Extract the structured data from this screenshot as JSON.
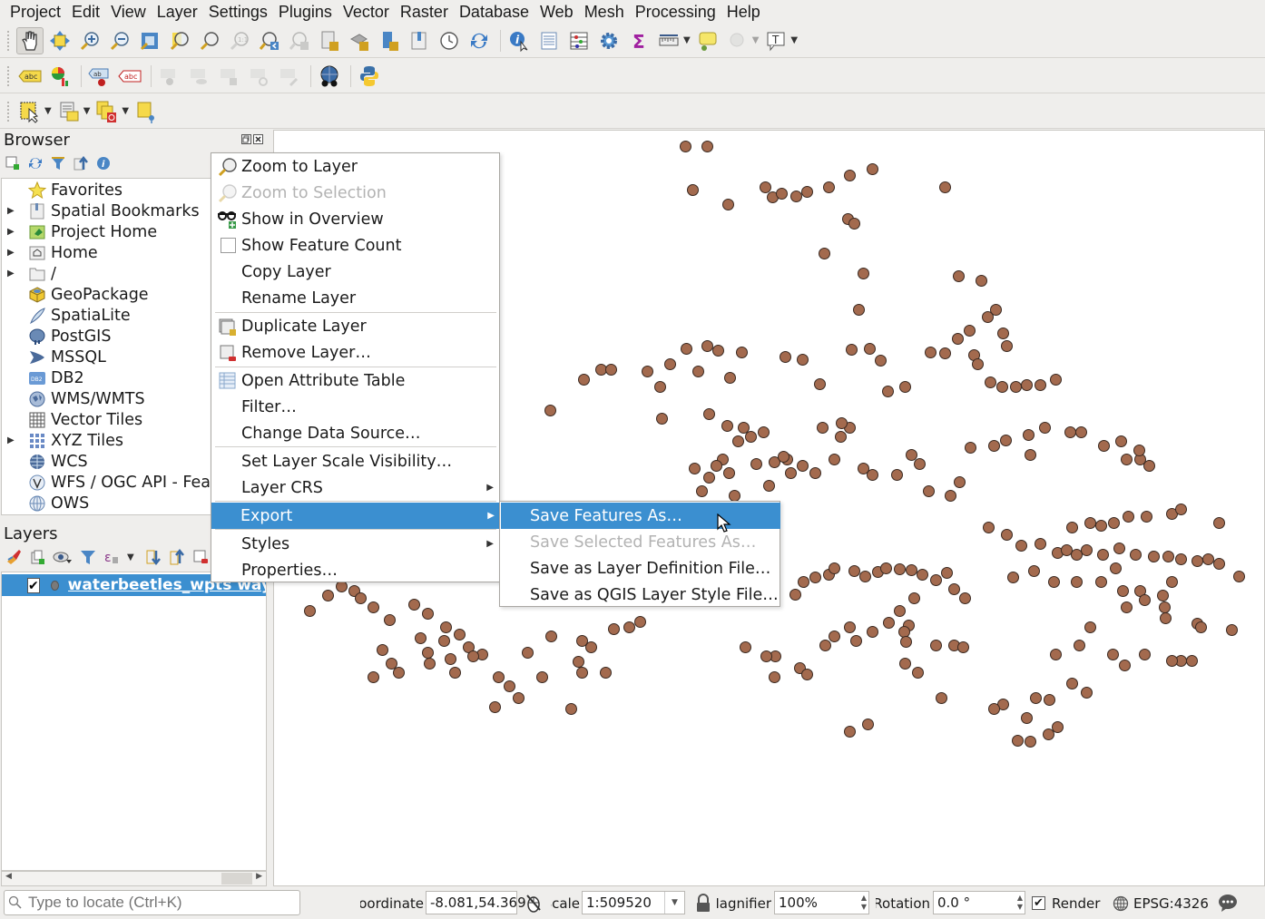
{
  "menubar": {
    "items": [
      {
        "label": "Project"
      },
      {
        "label": "Edit"
      },
      {
        "label": "View"
      },
      {
        "label": "Layer"
      },
      {
        "label": "Settings"
      },
      {
        "label": "Plugins"
      },
      {
        "label": "Vector"
      },
      {
        "label": "Raster"
      },
      {
        "label": "Database"
      },
      {
        "label": "Web"
      },
      {
        "label": "Mesh"
      },
      {
        "label": "Processing"
      },
      {
        "label": "Help"
      }
    ]
  },
  "browser": {
    "title": "Browser",
    "items": [
      {
        "label": "Favorites",
        "icon": "star-icon",
        "expandable": false
      },
      {
        "label": "Spatial Bookmarks",
        "icon": "bookmark-icon",
        "expandable": true
      },
      {
        "label": "Project Home",
        "icon": "project-home-icon",
        "expandable": true
      },
      {
        "label": "Home",
        "icon": "home-folder-icon",
        "expandable": true
      },
      {
        "label": "/",
        "icon": "folder-icon",
        "expandable": true
      },
      {
        "label": "GeoPackage",
        "icon": "geopackage-icon",
        "expandable": false
      },
      {
        "label": "SpatiaLite",
        "icon": "spatialite-icon",
        "expandable": false
      },
      {
        "label": "PostGIS",
        "icon": "postgis-icon",
        "expandable": false
      },
      {
        "label": "MSSQL",
        "icon": "mssql-icon",
        "expandable": false
      },
      {
        "label": "DB2",
        "icon": "db2-icon",
        "expandable": false
      },
      {
        "label": "WMS/WMTS",
        "icon": "wms-icon",
        "expandable": false
      },
      {
        "label": "Vector Tiles",
        "icon": "vector-tiles-icon",
        "expandable": false
      },
      {
        "label": "XYZ Tiles",
        "icon": "xyz-tiles-icon",
        "expandable": true
      },
      {
        "label": "WCS",
        "icon": "wcs-icon",
        "expandable": false
      },
      {
        "label": "WFS / OGC API - Features",
        "icon": "wfs-icon",
        "expandable": false
      },
      {
        "label": "OWS",
        "icon": "ows-icon",
        "expandable": false
      }
    ]
  },
  "layers": {
    "title": "Layers",
    "items": [
      {
        "label": "waterbeetles_wpts waypoints",
        "checked": true
      }
    ]
  },
  "context_menu": {
    "items": [
      {
        "label": "Zoom to Layer",
        "icon": "zoom-layer-icon",
        "disabled": false
      },
      {
        "label": "Zoom to Selection",
        "icon": "zoom-selection-icon",
        "disabled": true
      },
      {
        "label": "Show in Overview",
        "icon": "overview-glasses-icon",
        "disabled": false
      },
      {
        "label": "Show Feature Count",
        "icon": "checkbox",
        "disabled": false
      },
      {
        "label": "Copy Layer",
        "disabled": false
      },
      {
        "label": "Rename Layer",
        "disabled": false
      },
      {
        "label": "Duplicate Layer",
        "icon": "duplicate-layer-icon",
        "disabled": false
      },
      {
        "label": "Remove Layer…",
        "icon": "remove-layer-icon",
        "disabled": false
      },
      {
        "label": "Open Attribute Table",
        "icon": "attribute-table-icon",
        "disabled": false
      },
      {
        "label": "Filter…",
        "disabled": false
      },
      {
        "label": "Change Data Source…",
        "disabled": false
      },
      {
        "label": "Set Layer Scale Visibility…",
        "disabled": false
      },
      {
        "label": "Layer CRS",
        "submenu": true
      },
      {
        "label": "Export",
        "submenu": true,
        "highlighted": true
      },
      {
        "label": "Styles",
        "submenu": true
      },
      {
        "label": "Properties…",
        "disabled": false
      }
    ]
  },
  "export_submenu": {
    "items": [
      {
        "label": "Save Features As…",
        "highlighted": true
      },
      {
        "label": "Save Selected Features As…",
        "disabled": true
      },
      {
        "label": "Save as Layer Definition File…"
      },
      {
        "label": "Save as QGIS Layer Style File…"
      }
    ]
  },
  "statusbar": {
    "locate_placeholder": "Type to locate (Ctrl+K)",
    "coordinate_label": "Coordinate",
    "coordinate_value": "-8.081,54.369",
    "scale_label": "Scale",
    "scale_value": "1:509520",
    "magnifier_label": "Magnifier",
    "magnifier_value": "100%",
    "rotation_label": "Rotation",
    "rotation_value": "0.0 °",
    "render_label": "Render",
    "render_checked": true,
    "crs_label": "EPSG:4326"
  },
  "colors": {
    "accent": "#3b8fd0",
    "point_fill": "#a36a4e",
    "point_stroke": "#3a2a22"
  }
}
